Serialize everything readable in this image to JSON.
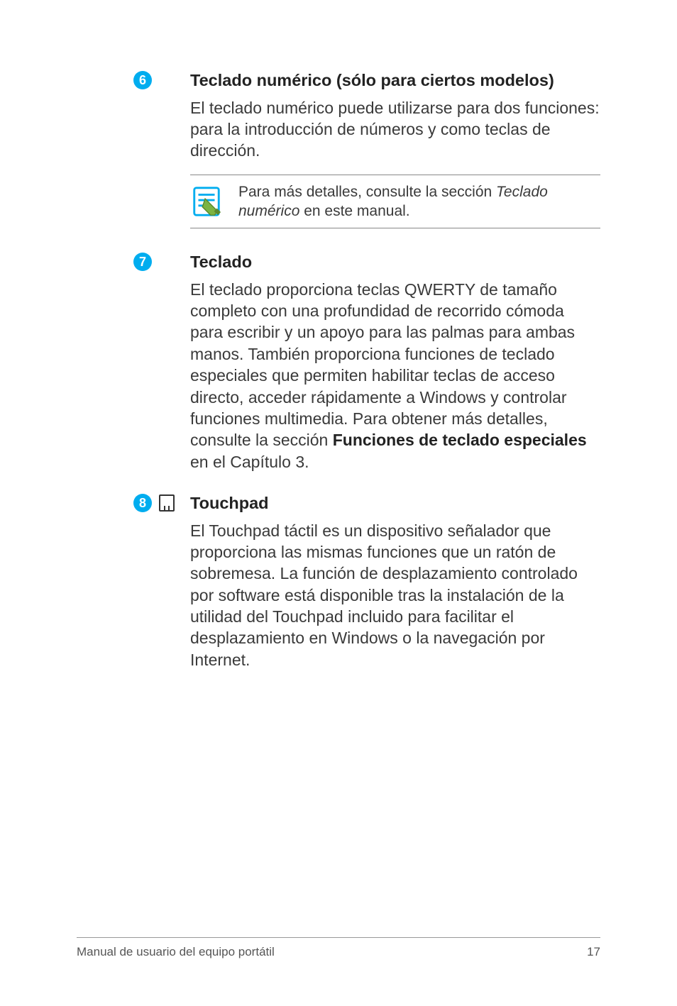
{
  "sections": [
    {
      "num": "6",
      "title": "Teclado numérico (sólo para ciertos modelos)",
      "body": "El teclado numérico puede utilizarse para dos funciones: para la introducción de números y como teclas de dirección.",
      "note_prefix": "Para más detalles, consulte la sección ",
      "note_italic": "Teclado numérico",
      "note_suffix": " en este manual."
    },
    {
      "num": "7",
      "title": "Teclado",
      "body_prefix": "El teclado proporciona teclas QWERTY de tamaño completo con una profundidad de recorrido cómoda para escribir y un apoyo para las palmas para ambas manos. También proporciona funciones de teclado especiales que permiten habilitar teclas de acceso directo, acceder rápidamente a Windows y controlar funciones multimedia. Para obtener más detalles, consulte la sección ",
      "body_bold": "Funciones de teclado especiales",
      "body_suffix": " en el Capítulo 3."
    },
    {
      "num": "8",
      "title": "Touchpad",
      "body": "El Touchpad táctil es un dispositivo señalador que proporciona las mismas funciones que un ratón de sobremesa. La función de desplazamiento controlado por software está disponible tras la instalación de la utilidad del Touchpad incluido para facilitar el desplazamiento en Windows o la navegación por Internet."
    }
  ],
  "footer": {
    "left": "Manual de usuario del equipo portátil",
    "right": "17"
  }
}
